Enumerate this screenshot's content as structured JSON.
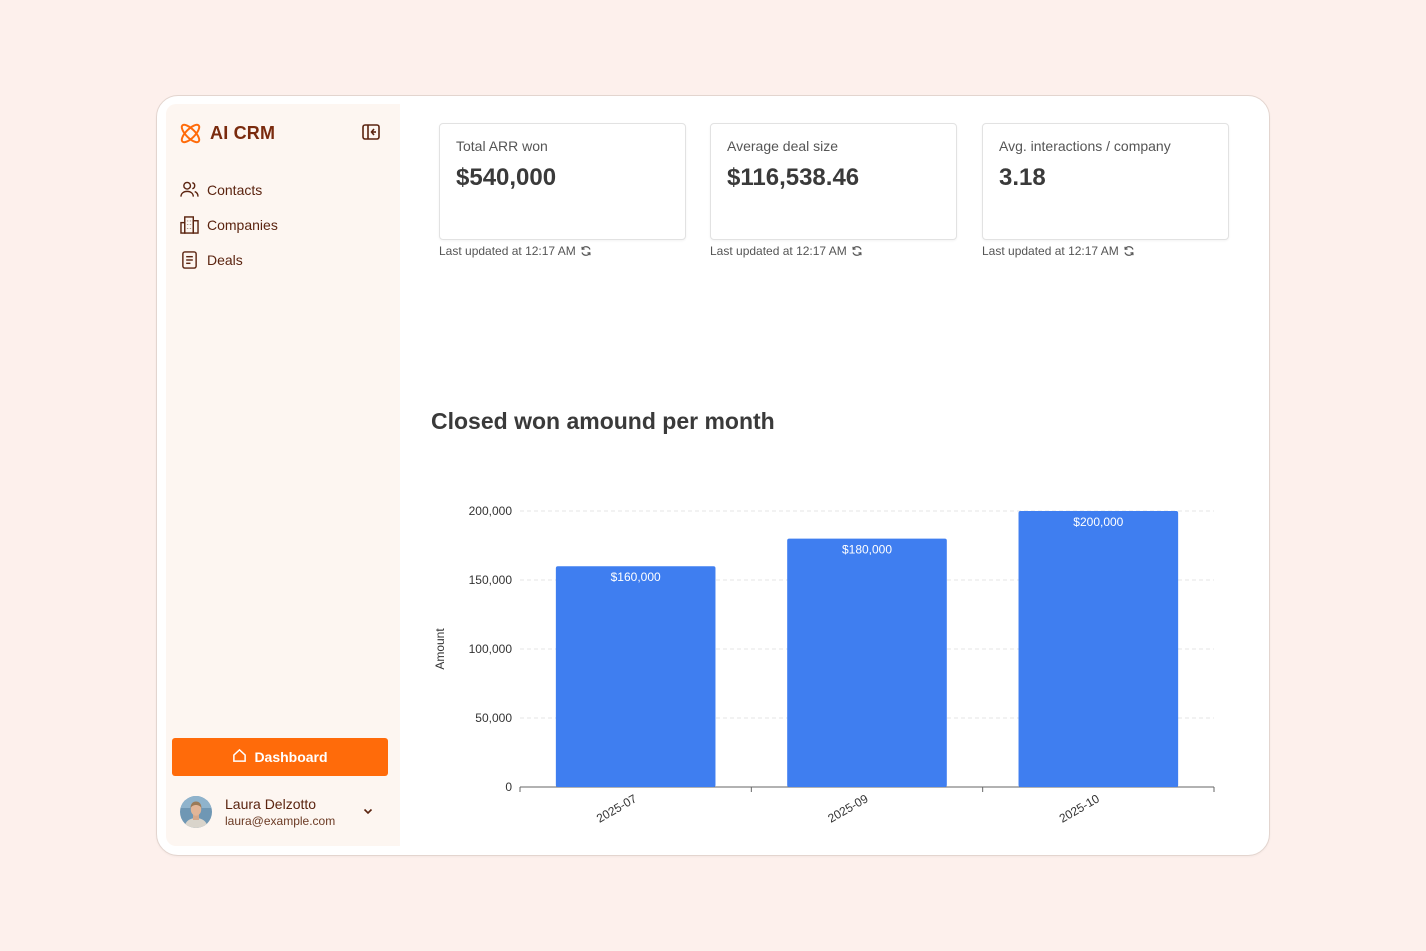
{
  "app": {
    "name": "AI CRM"
  },
  "sidebar": {
    "items": [
      {
        "label": "Contacts",
        "icon": "users-icon"
      },
      {
        "label": "Companies",
        "icon": "building-icon"
      },
      {
        "label": "Deals",
        "icon": "document-icon"
      }
    ],
    "dashboard_label": "Dashboard",
    "user": {
      "name": "Laura Delzotto",
      "email": "laura@example.com"
    }
  },
  "kpis": [
    {
      "label": "Total ARR won",
      "value": "$540,000",
      "updated": "Last updated at 12:17 AM"
    },
    {
      "label": "Average deal size",
      "value": "$116,538.46",
      "updated": "Last updated at 12:17 AM"
    },
    {
      "label": "Avg. interactions / company",
      "value": "3.18",
      "updated": "Last updated at 12:17 AM"
    }
  ],
  "colors": {
    "accent": "#ff6b0a",
    "brand_text": "#7a2b0e",
    "bar": "#3f7ef0",
    "page_bg": "#fdf0ec",
    "sidebar_bg": "#fdf6f1"
  },
  "chart_data": {
    "type": "bar",
    "title": "Closed won amound per month",
    "xlabel": "",
    "ylabel": "Amount",
    "categories": [
      "2025-07",
      "2025-09",
      "2025-10"
    ],
    "values": [
      160000,
      180000,
      200000
    ],
    "value_labels": [
      "$160,000",
      "$180,000",
      "$200,000"
    ],
    "yticks": [
      0,
      50000,
      100000,
      150000,
      200000
    ],
    "ytick_labels": [
      "0",
      "50,000",
      "100,000",
      "150,000",
      "200,000"
    ],
    "ylim": [
      0,
      200000
    ],
    "grid": true
  }
}
